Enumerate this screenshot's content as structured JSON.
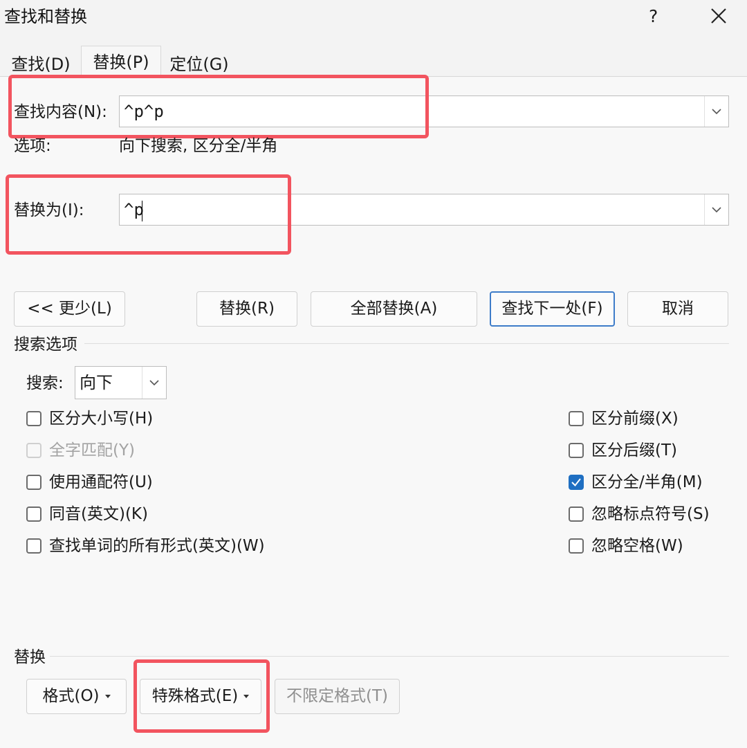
{
  "window": {
    "title": "查找和替换",
    "help_label": "?",
    "close_icon": "close-icon"
  },
  "tabs": [
    {
      "label": "查找(D)",
      "active": false
    },
    {
      "label": "替换(P)",
      "active": true
    },
    {
      "label": "定位(G)",
      "active": false
    }
  ],
  "find": {
    "label": "查找内容(N):",
    "value": "^p^p"
  },
  "options": {
    "label": "选项:",
    "value": "向下搜索, 区分全/半角"
  },
  "replace": {
    "label": "替换为(I):",
    "value": "^p"
  },
  "buttons": {
    "less": "<< 更少(L)",
    "replace": "替换(R)",
    "replace_all": "全部替换(A)",
    "find_next": "查找下一处(F)",
    "cancel": "取消"
  },
  "search_options": {
    "section_title": "搜索选项",
    "direction_label": "搜索:",
    "direction_value": "向下",
    "left_checks": [
      {
        "label": "区分大小写(H)",
        "checked": false,
        "disabled": false
      },
      {
        "label": "全字匹配(Y)",
        "checked": false,
        "disabled": true
      },
      {
        "label": "使用通配符(U)",
        "checked": false,
        "disabled": false
      },
      {
        "label": "同音(英文)(K)",
        "checked": false,
        "disabled": false
      },
      {
        "label": "查找单词的所有形式(英文)(W)",
        "checked": false,
        "disabled": false
      }
    ],
    "right_checks": [
      {
        "label": "区分前缀(X)",
        "checked": false,
        "disabled": false
      },
      {
        "label": "区分后缀(T)",
        "checked": false,
        "disabled": false
      },
      {
        "label": "区分全/半角(M)",
        "checked": true,
        "disabled": false
      },
      {
        "label": "忽略标点符号(S)",
        "checked": false,
        "disabled": false
      },
      {
        "label": "忽略空格(W)",
        "checked": false,
        "disabled": false
      }
    ]
  },
  "replace_section": {
    "title": "替换",
    "format_button": "格式(O)",
    "special_button": "特殊格式(E)",
    "no_format_button": "不限定格式(T)"
  },
  "colors": {
    "highlight": "#f2545f",
    "accent": "#1f6fc2",
    "primary_border": "#3d7cc9"
  }
}
